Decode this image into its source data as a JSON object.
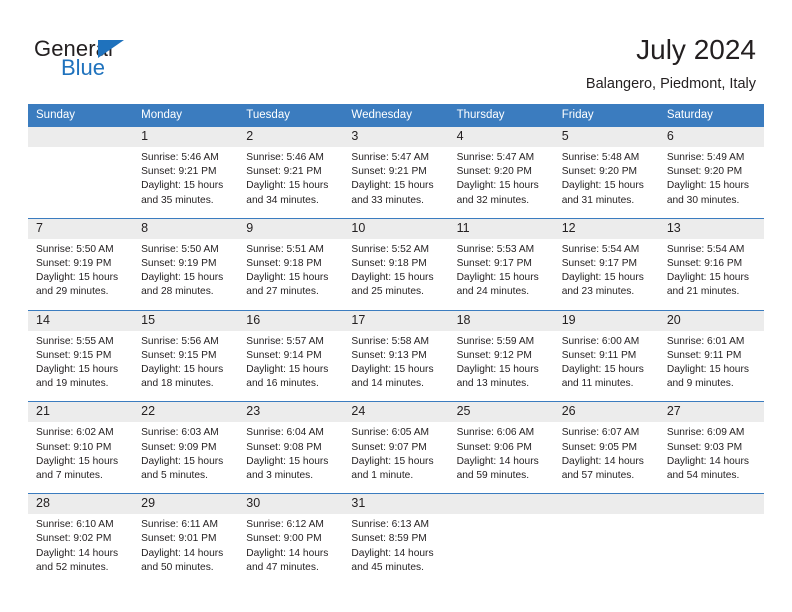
{
  "brand": {
    "name_dark": "General",
    "name_blue": "Blue",
    "accent_color": "#1f72bd"
  },
  "header": {
    "title": "July 2024",
    "location": "Balangero, Piedmont, Italy"
  },
  "theme": {
    "header_bg": "#3b7cbf",
    "daynum_bg": "#ececec",
    "text": "#231f20"
  },
  "calendar": {
    "weekday_headers": [
      "Sunday",
      "Monday",
      "Tuesday",
      "Wednesday",
      "Thursday",
      "Friday",
      "Saturday"
    ],
    "weeks": [
      [
        {
          "day": "",
          "sunrise": "",
          "sunset": "",
          "daylight_1": "",
          "daylight_2": ""
        },
        {
          "day": "1",
          "sunrise": "Sunrise: 5:46 AM",
          "sunset": "Sunset: 9:21 PM",
          "daylight_1": "Daylight: 15 hours",
          "daylight_2": "and 35 minutes."
        },
        {
          "day": "2",
          "sunrise": "Sunrise: 5:46 AM",
          "sunset": "Sunset: 9:21 PM",
          "daylight_1": "Daylight: 15 hours",
          "daylight_2": "and 34 minutes."
        },
        {
          "day": "3",
          "sunrise": "Sunrise: 5:47 AM",
          "sunset": "Sunset: 9:21 PM",
          "daylight_1": "Daylight: 15 hours",
          "daylight_2": "and 33 minutes."
        },
        {
          "day": "4",
          "sunrise": "Sunrise: 5:47 AM",
          "sunset": "Sunset: 9:20 PM",
          "daylight_1": "Daylight: 15 hours",
          "daylight_2": "and 32 minutes."
        },
        {
          "day": "5",
          "sunrise": "Sunrise: 5:48 AM",
          "sunset": "Sunset: 9:20 PM",
          "daylight_1": "Daylight: 15 hours",
          "daylight_2": "and 31 minutes."
        },
        {
          "day": "6",
          "sunrise": "Sunrise: 5:49 AM",
          "sunset": "Sunset: 9:20 PM",
          "daylight_1": "Daylight: 15 hours",
          "daylight_2": "and 30 minutes."
        }
      ],
      [
        {
          "day": "7",
          "sunrise": "Sunrise: 5:50 AM",
          "sunset": "Sunset: 9:19 PM",
          "daylight_1": "Daylight: 15 hours",
          "daylight_2": "and 29 minutes."
        },
        {
          "day": "8",
          "sunrise": "Sunrise: 5:50 AM",
          "sunset": "Sunset: 9:19 PM",
          "daylight_1": "Daylight: 15 hours",
          "daylight_2": "and 28 minutes."
        },
        {
          "day": "9",
          "sunrise": "Sunrise: 5:51 AM",
          "sunset": "Sunset: 9:18 PM",
          "daylight_1": "Daylight: 15 hours",
          "daylight_2": "and 27 minutes."
        },
        {
          "day": "10",
          "sunrise": "Sunrise: 5:52 AM",
          "sunset": "Sunset: 9:18 PM",
          "daylight_1": "Daylight: 15 hours",
          "daylight_2": "and 25 minutes."
        },
        {
          "day": "11",
          "sunrise": "Sunrise: 5:53 AM",
          "sunset": "Sunset: 9:17 PM",
          "daylight_1": "Daylight: 15 hours",
          "daylight_2": "and 24 minutes."
        },
        {
          "day": "12",
          "sunrise": "Sunrise: 5:54 AM",
          "sunset": "Sunset: 9:17 PM",
          "daylight_1": "Daylight: 15 hours",
          "daylight_2": "and 23 minutes."
        },
        {
          "day": "13",
          "sunrise": "Sunrise: 5:54 AM",
          "sunset": "Sunset: 9:16 PM",
          "daylight_1": "Daylight: 15 hours",
          "daylight_2": "and 21 minutes."
        }
      ],
      [
        {
          "day": "14",
          "sunrise": "Sunrise: 5:55 AM",
          "sunset": "Sunset: 9:15 PM",
          "daylight_1": "Daylight: 15 hours",
          "daylight_2": "and 19 minutes."
        },
        {
          "day": "15",
          "sunrise": "Sunrise: 5:56 AM",
          "sunset": "Sunset: 9:15 PM",
          "daylight_1": "Daylight: 15 hours",
          "daylight_2": "and 18 minutes."
        },
        {
          "day": "16",
          "sunrise": "Sunrise: 5:57 AM",
          "sunset": "Sunset: 9:14 PM",
          "daylight_1": "Daylight: 15 hours",
          "daylight_2": "and 16 minutes."
        },
        {
          "day": "17",
          "sunrise": "Sunrise: 5:58 AM",
          "sunset": "Sunset: 9:13 PM",
          "daylight_1": "Daylight: 15 hours",
          "daylight_2": "and 14 minutes."
        },
        {
          "day": "18",
          "sunrise": "Sunrise: 5:59 AM",
          "sunset": "Sunset: 9:12 PM",
          "daylight_1": "Daylight: 15 hours",
          "daylight_2": "and 13 minutes."
        },
        {
          "day": "19",
          "sunrise": "Sunrise: 6:00 AM",
          "sunset": "Sunset: 9:11 PM",
          "daylight_1": "Daylight: 15 hours",
          "daylight_2": "and 11 minutes."
        },
        {
          "day": "20",
          "sunrise": "Sunrise: 6:01 AM",
          "sunset": "Sunset: 9:11 PM",
          "daylight_1": "Daylight: 15 hours",
          "daylight_2": "and 9 minutes."
        }
      ],
      [
        {
          "day": "21",
          "sunrise": "Sunrise: 6:02 AM",
          "sunset": "Sunset: 9:10 PM",
          "daylight_1": "Daylight: 15 hours",
          "daylight_2": "and 7 minutes."
        },
        {
          "day": "22",
          "sunrise": "Sunrise: 6:03 AM",
          "sunset": "Sunset: 9:09 PM",
          "daylight_1": "Daylight: 15 hours",
          "daylight_2": "and 5 minutes."
        },
        {
          "day": "23",
          "sunrise": "Sunrise: 6:04 AM",
          "sunset": "Sunset: 9:08 PM",
          "daylight_1": "Daylight: 15 hours",
          "daylight_2": "and 3 minutes."
        },
        {
          "day": "24",
          "sunrise": "Sunrise: 6:05 AM",
          "sunset": "Sunset: 9:07 PM",
          "daylight_1": "Daylight: 15 hours",
          "daylight_2": "and 1 minute."
        },
        {
          "day": "25",
          "sunrise": "Sunrise: 6:06 AM",
          "sunset": "Sunset: 9:06 PM",
          "daylight_1": "Daylight: 14 hours",
          "daylight_2": "and 59 minutes."
        },
        {
          "day": "26",
          "sunrise": "Sunrise: 6:07 AM",
          "sunset": "Sunset: 9:05 PM",
          "daylight_1": "Daylight: 14 hours",
          "daylight_2": "and 57 minutes."
        },
        {
          "day": "27",
          "sunrise": "Sunrise: 6:09 AM",
          "sunset": "Sunset: 9:03 PM",
          "daylight_1": "Daylight: 14 hours",
          "daylight_2": "and 54 minutes."
        }
      ],
      [
        {
          "day": "28",
          "sunrise": "Sunrise: 6:10 AM",
          "sunset": "Sunset: 9:02 PM",
          "daylight_1": "Daylight: 14 hours",
          "daylight_2": "and 52 minutes."
        },
        {
          "day": "29",
          "sunrise": "Sunrise: 6:11 AM",
          "sunset": "Sunset: 9:01 PM",
          "daylight_1": "Daylight: 14 hours",
          "daylight_2": "and 50 minutes."
        },
        {
          "day": "30",
          "sunrise": "Sunrise: 6:12 AM",
          "sunset": "Sunset: 9:00 PM",
          "daylight_1": "Daylight: 14 hours",
          "daylight_2": "and 47 minutes."
        },
        {
          "day": "31",
          "sunrise": "Sunrise: 6:13 AM",
          "sunset": "Sunset: 8:59 PM",
          "daylight_1": "Daylight: 14 hours",
          "daylight_2": "and 45 minutes."
        },
        {
          "day": "",
          "sunrise": "",
          "sunset": "",
          "daylight_1": "",
          "daylight_2": ""
        },
        {
          "day": "",
          "sunrise": "",
          "sunset": "",
          "daylight_1": "",
          "daylight_2": ""
        },
        {
          "day": "",
          "sunrise": "",
          "sunset": "",
          "daylight_1": "",
          "daylight_2": ""
        }
      ]
    ]
  }
}
